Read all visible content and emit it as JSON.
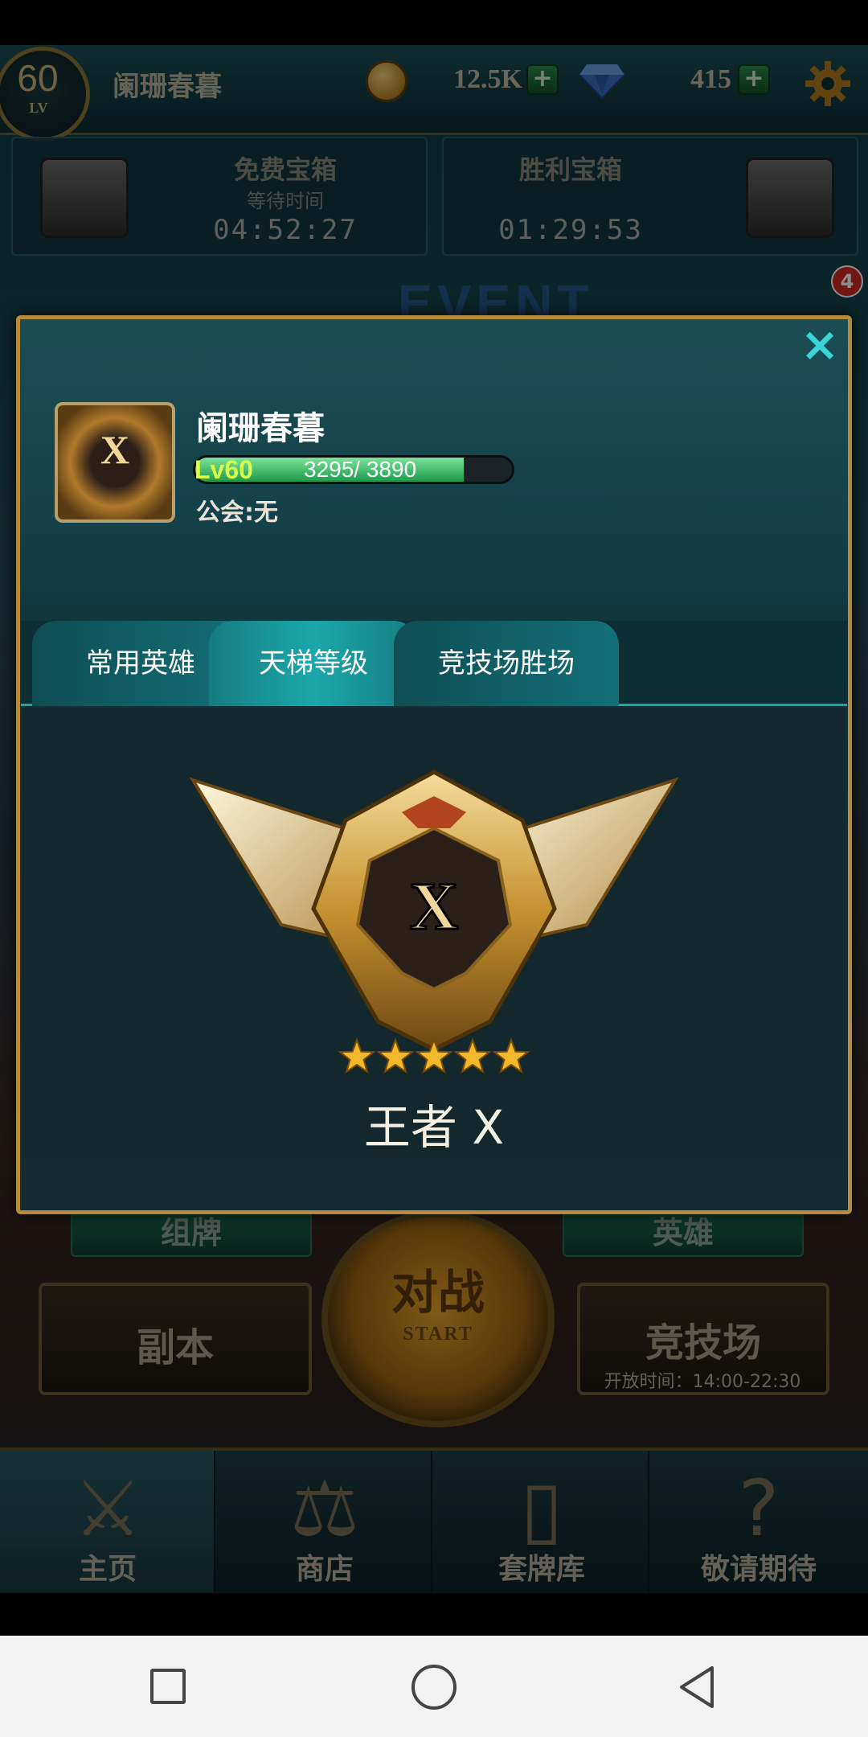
{
  "top_bar": {
    "level": "60",
    "level_label": "LV",
    "player_name": "阑珊春暮",
    "coins": "12.5K",
    "gems": "415",
    "plus": "+"
  },
  "chests": {
    "free": {
      "title": "免费宝箱",
      "subtitle": "等待时间",
      "time": "04:52:27"
    },
    "victory": {
      "title": "胜利宝箱",
      "time": "01:29:53"
    }
  },
  "event_banner": {
    "text": "EVENT",
    "badge_count": "4"
  },
  "profile": {
    "close": "×",
    "avatar_letter": "X",
    "name": "阑珊春暮",
    "level_label": "Lv60",
    "xp_current": "3295",
    "xp_max": "3890",
    "xp_text": "3295/ 3890",
    "xp_fraction": 0.847,
    "guild": "公会:无",
    "tabs": [
      {
        "label": "常用英雄",
        "active": false
      },
      {
        "label": "天梯等级",
        "active": true
      },
      {
        "label": "竞技场胜场",
        "active": false
      }
    ],
    "rank": {
      "emblem_letter": "X",
      "stars": 5,
      "name": "王者 X"
    }
  },
  "game_menu": {
    "deck_tab": "组牌",
    "hero_tab": "英雄",
    "dungeon": "副本",
    "battle": "对战",
    "battle_sub": "START",
    "arena": "竞技场",
    "arena_time": "开放时间：14:00-22:30"
  },
  "bottom_nav": [
    {
      "label": "主页",
      "icon": "crossed-swords-icon",
      "active": true
    },
    {
      "label": "商店",
      "icon": "scales-icon",
      "active": false
    },
    {
      "label": "套牌库",
      "icon": "cards-icon",
      "active": false
    },
    {
      "label": "敬请期待",
      "icon": "question-icon",
      "active": false
    }
  ],
  "colors": {
    "accent_teal": "#1ca8ab",
    "frame_gold": "#b58a3a",
    "xp_green": "#1c9a4b",
    "badge_red": "#d02a1f"
  }
}
